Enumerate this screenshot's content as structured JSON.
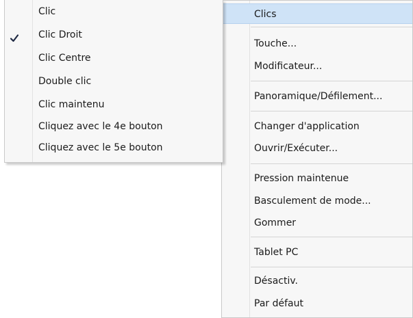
{
  "main_menu": {
    "items": [
      {
        "label": "Clics"
      },
      {
        "label": "Touche..."
      },
      {
        "label": "Modificateur..."
      },
      {
        "label": "Panoramique/Défilement..."
      },
      {
        "label": "Changer d'application"
      },
      {
        "label": "Ouvrir/Exécuter..."
      },
      {
        "label": "Pression maintenue"
      },
      {
        "label": "Basculement de mode..."
      },
      {
        "label": "Gommer"
      },
      {
        "label": "Tablet PC"
      },
      {
        "label": "Désactiv."
      },
      {
        "label": "Par défaut"
      }
    ]
  },
  "sub_menu": {
    "items": [
      {
        "label": "Clic"
      },
      {
        "label": "Clic Droit",
        "checked": true
      },
      {
        "label": "Clic Centre"
      },
      {
        "label": "Double clic"
      },
      {
        "label": "Clic maintenu"
      },
      {
        "label": "Cliquez avec le 4e bouton"
      },
      {
        "label": "Cliquez avec le 5e bouton"
      }
    ]
  },
  "colors": {
    "highlight": "#cfe3f7",
    "menu_bg": "#f7f7f7",
    "separator": "#d4d4d4"
  },
  "icons": {
    "checkmark": "check-icon"
  }
}
